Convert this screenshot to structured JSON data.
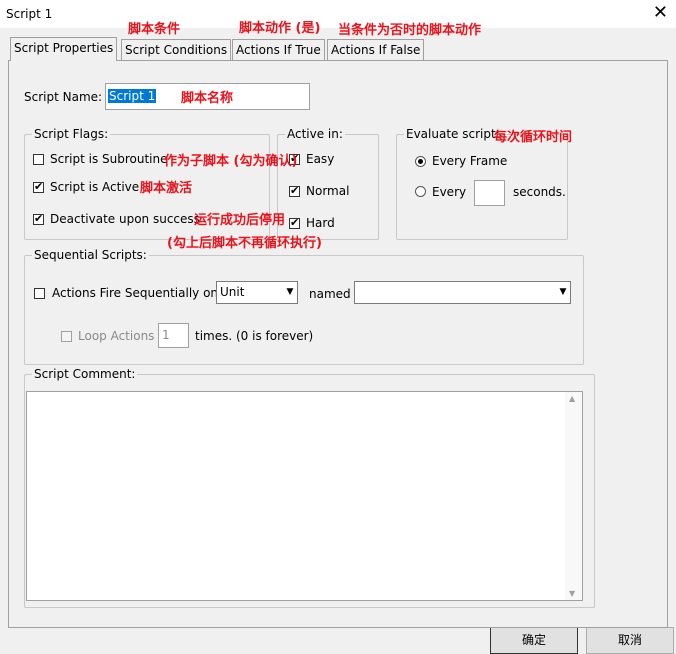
{
  "window": {
    "title": "Script 1",
    "close_glyph": "✕"
  },
  "tabs": [
    {
      "label": "Script Properties",
      "active": true
    },
    {
      "label": "Script Conditions"
    },
    {
      "label": "Actions If True"
    },
    {
      "label": "Actions If False"
    }
  ],
  "annotations": {
    "conditions": "脚本条件",
    "actions_true": "脚本动作 (是)",
    "actions_false": "当条件为否时的脚本动作",
    "script_name": "脚本名称",
    "subroutine": "作为子脚本 (勾为确认)",
    "active": "脚本激活",
    "deactivate_1": "运行成功后停用",
    "deactivate_2": "(勾上后脚本不再循环执行)",
    "evaluate": "每次循环时间"
  },
  "script_name": {
    "label": "Script Name:",
    "value": "Script 1"
  },
  "script_flags": {
    "legend": "Script Flags:",
    "items": [
      {
        "label": "Script is Subroutine",
        "checked": false
      },
      {
        "label": "Script is Active",
        "checked": true
      },
      {
        "label": "Deactivate upon success",
        "checked": true
      }
    ]
  },
  "active_in": {
    "legend": "Active in:",
    "items": [
      {
        "label": "Easy",
        "checked": true
      },
      {
        "label": "Normal",
        "checked": true
      },
      {
        "label": "Hard",
        "checked": true
      }
    ]
  },
  "evaluate": {
    "legend": "Evaluate script:",
    "every_frame": "Every Frame",
    "every": "Every",
    "seconds": "seconds.",
    "seconds_value": ""
  },
  "sequential": {
    "legend": "Sequential Scripts:",
    "fire_label": "Actions Fire Sequentially on",
    "fire_checked": false,
    "on_value": "Unit",
    "named_label": "named",
    "named_value": "",
    "loop_label": "Loop Actions",
    "loop_value": "1",
    "times_label": "times. (0 is forever)"
  },
  "comment": {
    "legend": "Script Comment:",
    "value": ""
  },
  "buttons": {
    "ok": "确定",
    "cancel": "取消"
  }
}
